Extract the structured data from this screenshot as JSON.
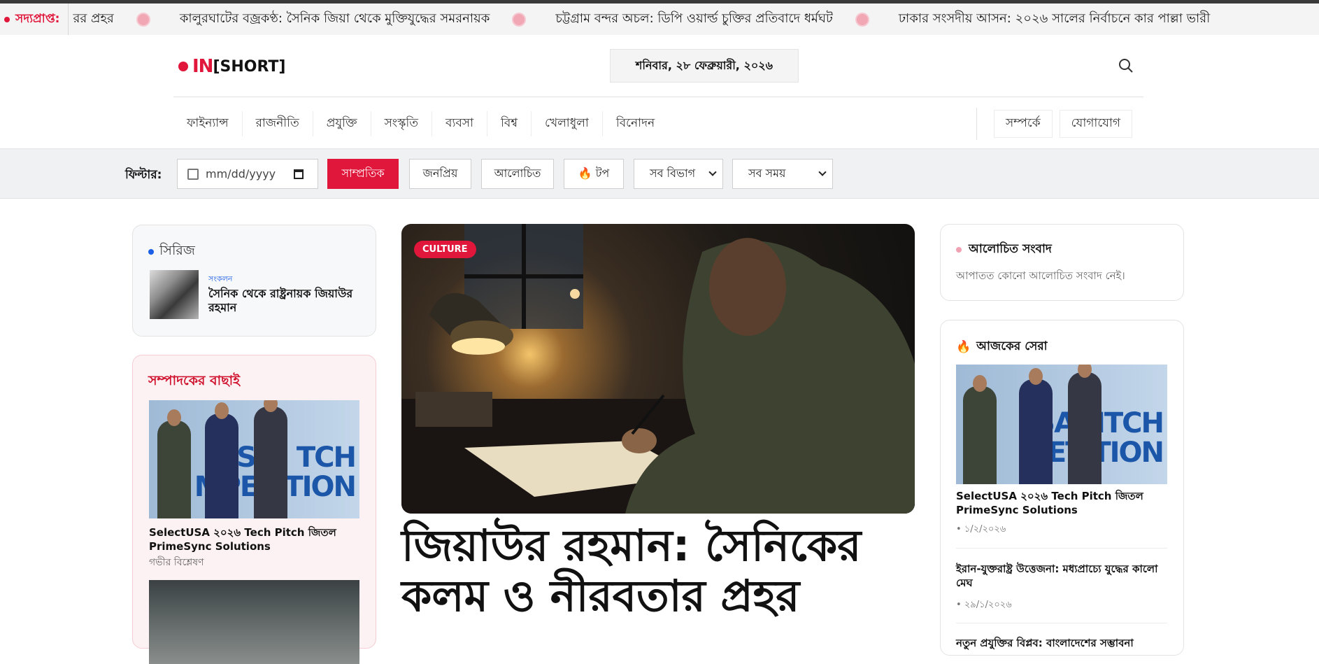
{
  "ticker": {
    "label": "সদ্যপ্রাপ্ত:",
    "items": [
      "রর প্রহর",
      "কালুরঘাটের বজ্রকণ্ঠ: সৈনিক জিয়া থেকে মুক্তিযুদ্ধের সমরনায়ক",
      "চট্টগ্রাম বন্দর অচল: ডিপি ওয়ার্ল্ড চুক্তির প্রতিবাদে ধর্মঘট",
      "ঢাকার সংসদীয় আসন: ২০২৬ সালের নির্বাচনে কার পাল্লা ভারী"
    ]
  },
  "header": {
    "logo_left": "IN",
    "logo_right": "[SHORT]",
    "date": "শনিবার, ২৮ ফেব্রুয়ারী, ২০২৬",
    "nav": [
      "ফাইন্যান্স",
      "রাজনীতি",
      "প্রযুক্তি",
      "সংস্কৃতি",
      "ব্যবসা",
      "বিশ্ব",
      "খেলাধুলা",
      "বিনোদন"
    ],
    "nav_right": [
      "সম্পর্কে",
      "যোগাযোগ"
    ]
  },
  "filter": {
    "label": "ফিল্টার:",
    "date_placeholder": "mm/dd/yyyy",
    "buttons": [
      "সাম্প্রতিক",
      "জনপ্রিয়",
      "আলোচিত",
      "🔥 টপ"
    ],
    "active_button": "সাম্প্রতিক",
    "category_select": "সব বিভাগ",
    "time_select": "সব সময়"
  },
  "series": {
    "title": "সিরিজ",
    "tag": "সংকলন",
    "headline": "সৈনিক থেকে রাষ্ট্রনায়ক জিয়াউর রহমান"
  },
  "editors_pick": {
    "title": "সম্পাদকের বাছাই",
    "item1_caption": "SelectUSA ২০২৬ Tech Pitch জিতল PrimeSync Solutions",
    "item1_sub": "গভীর বিশ্লেষণ",
    "photo_text": "SA° TCH MPETITION"
  },
  "hero": {
    "badge": "CULTURE",
    "title": "জিয়াউর রহমান: সৈনিকের কলম ও নীরবতার প্রহর"
  },
  "discussed": {
    "title": "আলোচিত সংবাদ",
    "empty": "আপাতত কোনো আলোচিত সংবাদ নেই।"
  },
  "best_today": {
    "title": "আজকের সেরা",
    "item1_caption": "SelectUSA ২০২৬ Tech Pitch জিতল PrimeSync Solutions",
    "item1_date": "১/২/২০২৬",
    "item2_caption": "ইরান-যুক্তরাষ্ট্র উত্তেজনা: মধ্যপ্রাচ্যে যুদ্ধের কালো মেঘ",
    "item2_date": "২৯/১/২০২৬",
    "item3_caption": "নতুন প্রযুক্তির বিপ্লব: বাংলাদেশের সম্ভাবনা",
    "photo_text": "SA° ITCH ETITION"
  },
  "colors": {
    "accent": "#e0163a",
    "link_blue": "#1d5ee8"
  }
}
